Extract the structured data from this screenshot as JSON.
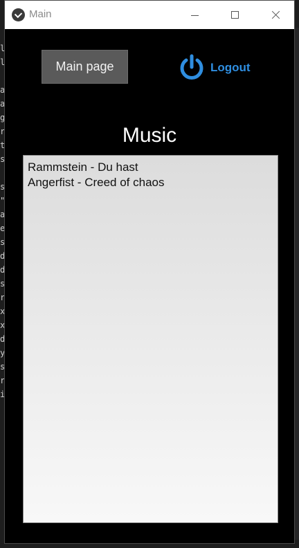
{
  "window": {
    "title": "Main"
  },
  "background": {
    "code_column": "l\nl\n\na\na\ng\nr\nt\ns\n\ns\n\"\na\ne\ns\nd\nd\ns\nr\nx\nx\nd\ny\ns\nr\ni"
  },
  "header": {
    "main_page_label": "Main page",
    "logout_label": "Logout",
    "logout_icon": "power-icon"
  },
  "colors": {
    "accent": "#2f8ee0",
    "content_background": "#000000",
    "button_background": "#5a5a5a"
  },
  "section": {
    "title": "Music"
  },
  "music_list": {
    "items": [
      "Rammstein - Du hast",
      "Angerfist - Creed of chaos"
    ]
  }
}
